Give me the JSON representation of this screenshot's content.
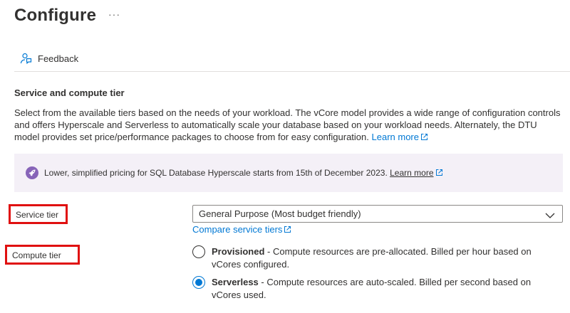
{
  "header": {
    "title": "Configure",
    "more_label": "···"
  },
  "toolbar": {
    "feedback_label": "Feedback"
  },
  "section": {
    "title": "Service and compute tier",
    "description": "Select from the available tiers based on the needs of your workload. The vCore model provides a wide range of configuration controls and offers Hyperscale and Serverless to automatically scale your database based on your workload needs. Alternately, the DTU model provides set price/performance packages to choose from for easy configuration.",
    "learn_more_label": "Learn more"
  },
  "banner": {
    "text": "Lower, simplified pricing for SQL Database Hyperscale starts from 15th of December 2023.",
    "learn_more_label": "Learn more"
  },
  "service_tier": {
    "label": "Service tier",
    "selected_value": "General Purpose (Most budget friendly)",
    "compare_link_label": "Compare service tiers"
  },
  "compute_tier": {
    "label": "Compute tier",
    "options": [
      {
        "name": "Provisioned",
        "description": " - Compute resources are pre-allocated. Billed per hour based on vCores configured.",
        "checked": false
      },
      {
        "name": "Serverless",
        "description": " - Compute resources are auto-scaled. Billed per second based on vCores used.",
        "checked": true
      }
    ]
  },
  "colors": {
    "link": "#0078d4",
    "banner_bg": "#f4f0f7",
    "banner_icon": "#8764b8",
    "highlight_border": "#e01010",
    "radio_selected": "#0078d4"
  },
  "icons": {
    "feedback": "feedback-icon",
    "external_link": "external-link-icon",
    "rocket": "rocket-icon",
    "dropdown": "chevron-down-icon"
  }
}
